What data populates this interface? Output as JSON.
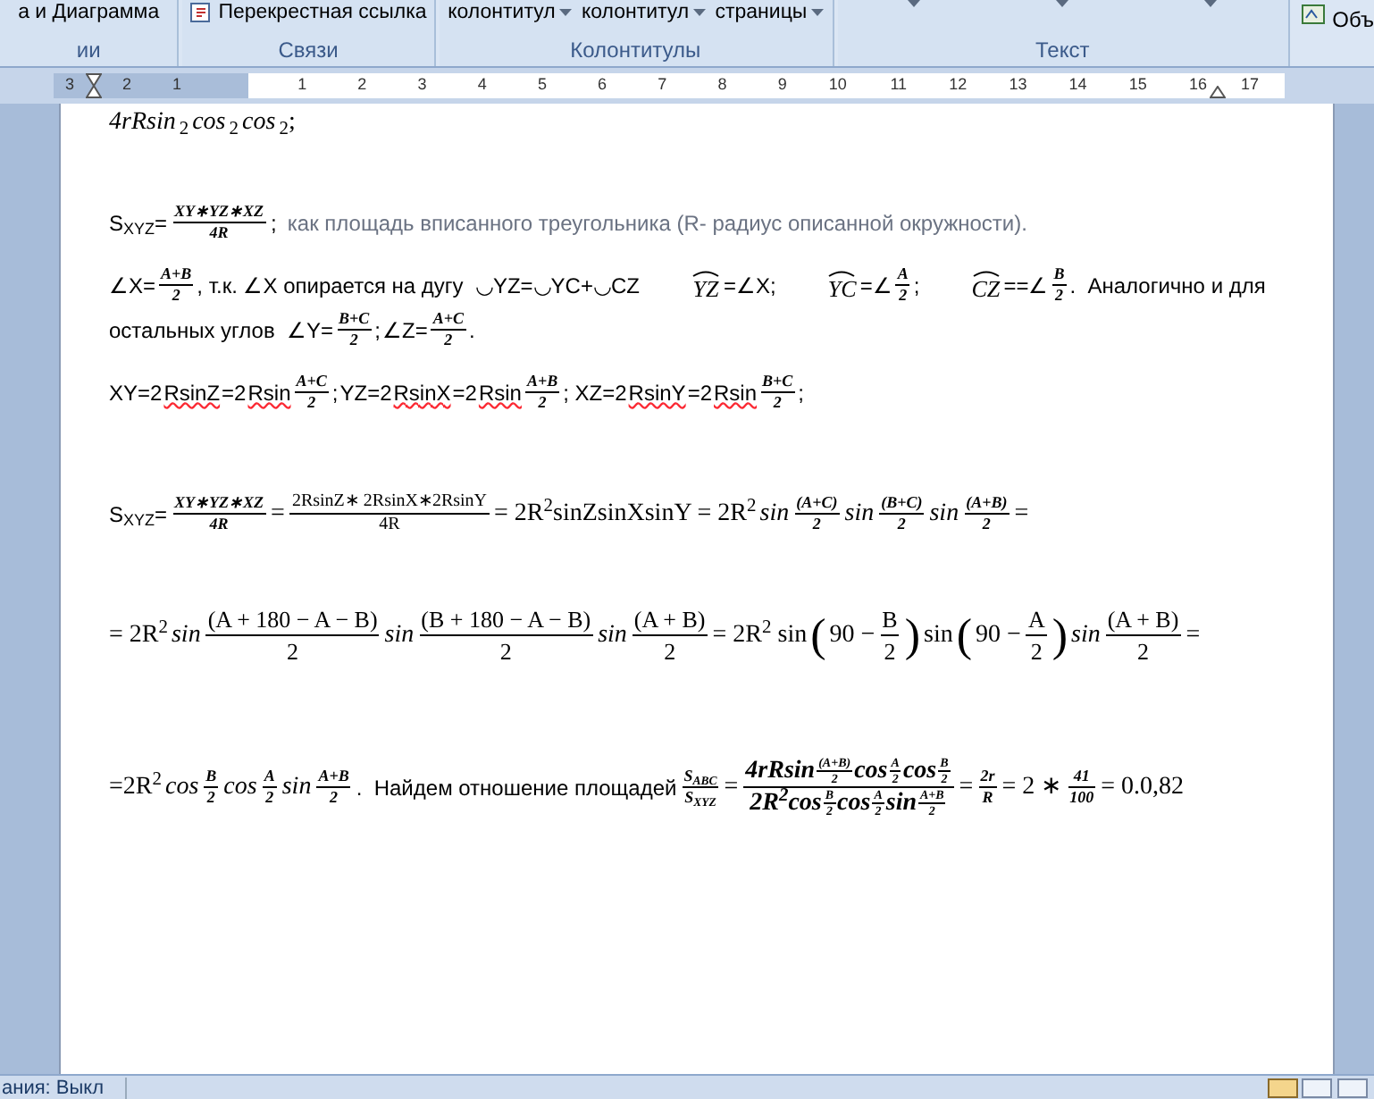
{
  "ribbon": {
    "groups": [
      {
        "label": "ии",
        "buttons": [
          {
            "kind": "plain",
            "label": "а и Диаграмма"
          }
        ]
      },
      {
        "label": "Связи",
        "buttons": [
          {
            "kind": "document",
            "label": "Перекрестная ссылка"
          }
        ]
      },
      {
        "label": "Колонтитулы",
        "buttons": [
          {
            "kind": "dropdown",
            "label": "колонтитул"
          },
          {
            "kind": "dropdown",
            "label": "колонтитул"
          },
          {
            "kind": "dropdown",
            "label": "страницы"
          }
        ]
      },
      {
        "label": "Текст",
        "buttons": [
          {
            "kind": "dropdown"
          },
          {
            "kind": "dropdown"
          },
          {
            "kind": "dropdown"
          }
        ]
      }
    ],
    "extra": "Объ"
  },
  "ruler": {
    "left_marks": [
      "3",
      "2",
      "1"
    ],
    "right_marks": [
      "1",
      "2",
      "3",
      "4",
      "5",
      "6",
      "7",
      "8",
      "9",
      "10",
      "11",
      "12",
      "13",
      "14",
      "15",
      "16",
      "17"
    ]
  },
  "document": {
    "lines": [
      [
        {
          "kind": "variable",
          "text": "4rRsin"
        },
        {
          "kind": "math",
          "text": "$_{2}$"
        },
        {
          "kind": "variable",
          "text": "cos"
        },
        {
          "kind": "math",
          "text": "$_{2}$"
        },
        {
          "kind": "variable",
          "text": "cos"
        },
        {
          "kind": "math",
          "text": "$_{2}$;"
        }
      ],
      [
        {
          "kind": "text",
          "text": "S$_{XYZ}$="
        },
        {
          "kind": "fraction",
          "num": "XY∗YZ∗XZ",
          "den": "4R"
        },
        {
          "kind": "text",
          "text": ";"
        },
        {
          "kind": "remark",
          "text": "как площадь вписанного треугольника (R- радиус описанной окружности)."
        }
      ],
      [
        {
          "kind": "text",
          "text": "∠X="
        },
        {
          "kind": "fraction",
          "num": "A+B",
          "den": "2"
        },
        {
          "kind": "text",
          "text": ", т.к. ∠X опирается на дугу  ◡YZ=◡YC+◡CZ"
        },
        {
          "kind": "arc",
          "text": "YZ"
        },
        {
          "kind": "text",
          "text": "=∠X;"
        },
        {
          "kind": "arc",
          "text": "YC"
        },
        {
          "kind": "text",
          "text": "=∠"
        },
        {
          "kind": "fraction",
          "num": "A",
          "den": "2"
        },
        {
          "kind": "text",
          "text": ";"
        },
        {
          "kind": "arc",
          "text": "CZ"
        },
        {
          "kind": "text",
          "text": "==∠"
        },
        {
          "kind": "fraction",
          "num": "B",
          "den": "2"
        },
        {
          "kind": "text",
          "text": ".  Аналогично и для"
        }
      ],
      [
        {
          "kind": "text",
          "text": "остальных углов  ∠Y="
        },
        {
          "kind": "fraction",
          "num": "B+C",
          "den": "2"
        },
        {
          "kind": "text",
          "text": ";"
        },
        {
          "kind": "text",
          "text": "∠Z="
        },
        {
          "kind": "fraction",
          "num": "A+C",
          "den": "2"
        },
        {
          "kind": "text",
          "text": "."
        }
      ],
      [
        {
          "kind": "text",
          "text": "XY=2"
        },
        {
          "kind": "misspelled",
          "text": "RsinZ"
        },
        {
          "kind": "text",
          "text": "=2"
        },
        {
          "kind": "misspelled",
          "text": "Rsin"
        },
        {
          "kind": "fraction",
          "num": "A+C",
          "den": "2"
        },
        {
          "kind": "text",
          "text": ";"
        },
        {
          "kind": "text",
          "text": "YZ=2"
        },
        {
          "kind": "misspelled",
          "text": "RsinX"
        },
        {
          "kind": "text",
          "text": "=2"
        },
        {
          "kind": "misspelled",
          "text": "Rsin"
        },
        {
          "kind": "fraction",
          "num": "A+B",
          "den": "2"
        },
        {
          "kind": "text",
          "text": "; XZ=2"
        },
        {
          "kind": "misspelled",
          "text": "RsinY"
        },
        {
          "kind": "text",
          "text": "=2"
        },
        {
          "kind": "misspelled",
          "text": "Rsin"
        },
        {
          "kind": "fraction",
          "num": "B+C",
          "den": "2"
        },
        {
          "kind": "text",
          "text": ";"
        }
      ],
      [
        {
          "kind": "text",
          "text": "S$_{XYZ}$="
        },
        {
          "kind": "fraction",
          "num": "XY∗YZ∗XZ",
          "den": "4R"
        },
        {
          "kind": "math",
          "text": "="
        },
        {
          "kind": "plainfraction",
          "num": "2RsinZ∗ 2RsinX∗2RsinY",
          "den": "4R"
        },
        {
          "kind": "math",
          "text": "= 2R$^{2}$sinZsinXsinY = 2R$^{2}$"
        },
        {
          "kind": "variable",
          "text": "sin"
        },
        {
          "kind": "fraction",
          "num": "(A+C)",
          "den": "2"
        },
        {
          "kind": "variable",
          "text": "sin"
        },
        {
          "kind": "fraction",
          "num": "(B+C)",
          "den": "2"
        },
        {
          "kind": "variable",
          "text": "sin"
        },
        {
          "kind": "fraction",
          "num": "(A+B)",
          "den": "2"
        },
        {
          "kind": "math",
          "text": "="
        }
      ],
      [
        {
          "kind": "math",
          "text": "= 2R$^{2}$"
        },
        {
          "kind": "variable",
          "text": "sin"
        },
        {
          "kind": "bigfraction",
          "num": "(A + 180 − A − B)",
          "den": "2"
        },
        {
          "kind": "variable",
          "text": "sin"
        },
        {
          "kind": "bigfraction",
          "num": "(B + 180 − A − B)",
          "den": "2"
        },
        {
          "kind": "variable",
          "text": "sin"
        },
        {
          "kind": "bigfraction",
          "num": "(A + B)",
          "den": "2"
        },
        {
          "kind": "math",
          "text": "= 2R$^{2}$ sin"
        },
        {
          "kind": "paren",
          "text": "("
        },
        {
          "kind": "math",
          "text": "90 −"
        },
        {
          "kind": "bigfraction",
          "num": "B",
          "den": "2"
        },
        {
          "kind": "paren",
          "text": ")"
        },
        {
          "kind": "math",
          "text": "sin"
        },
        {
          "kind": "paren",
          "text": "("
        },
        {
          "kind": "math",
          "text": "90 −"
        },
        {
          "kind": "bigfraction",
          "num": "A",
          "den": "2"
        },
        {
          "kind": "paren",
          "text": ")"
        },
        {
          "kind": "variable",
          "text": "sin"
        },
        {
          "kind": "bigfraction",
          "num": "(A + B)",
          "den": "2"
        },
        {
          "kind": "math",
          "text": "="
        }
      ],
      [
        {
          "kind": "math",
          "text": "=2R$^{2}$"
        },
        {
          "kind": "variable",
          "text": "cos"
        },
        {
          "kind": "fraction",
          "num": "B",
          "den": "2"
        },
        {
          "kind": "variable",
          "text": "cos"
        },
        {
          "kind": "fraction",
          "num": "A",
          "den": "2"
        },
        {
          "kind": "variable",
          "text": "sin"
        },
        {
          "kind": "fraction",
          "num": "A+B",
          "den": "2"
        },
        {
          "kind": "text",
          "text": ".  Найдем отношение площадей"
        },
        {
          "kind": "fraction",
          "num": "S$_{ABC}$",
          "den": "S$_{XYZ}$"
        },
        {
          "kind": "math",
          "text": "="
        },
        {
          "kind": "fraction",
          "num": [
            {
              "kind": "variable",
              "text": "4rRsin"
            },
            {
              "kind": "tinyfraction",
              "num": "(A+B)",
              "den": "2"
            },
            {
              "kind": "variable",
              "text": "cos"
            },
            {
              "kind": "tinyfraction",
              "num": "A",
              "den": "2"
            },
            {
              "kind": "variable",
              "text": "cos"
            },
            {
              "kind": "tinyfraction",
              "num": "B",
              "den": "2"
            }
          ],
          "den": [
            {
              "kind": "variable",
              "text": "2R$^{2}$cos"
            },
            {
              "kind": "tinyfraction",
              "num": "B",
              "den": "2"
            },
            {
              "kind": "variable",
              "text": "cos"
            },
            {
              "kind": "tinyfraction",
              "num": "A",
              "den": "2"
            },
            {
              "kind": "variable",
              "text": "sin"
            },
            {
              "kind": "tinyfraction",
              "num": "A+B",
              "den": "2"
            }
          ]
        },
        {
          "kind": "math",
          "text": "="
        },
        {
          "kind": "fraction",
          "num": "2r",
          "den": "R"
        },
        {
          "kind": "math",
          "text": "= 2 ∗"
        },
        {
          "kind": "fraction",
          "num": "41",
          "den": "100"
        },
        {
          "kind": "math",
          "text": "= 0.0,82"
        }
      ]
    ]
  },
  "status_bar": {
    "text": "ания: Выкл"
  }
}
